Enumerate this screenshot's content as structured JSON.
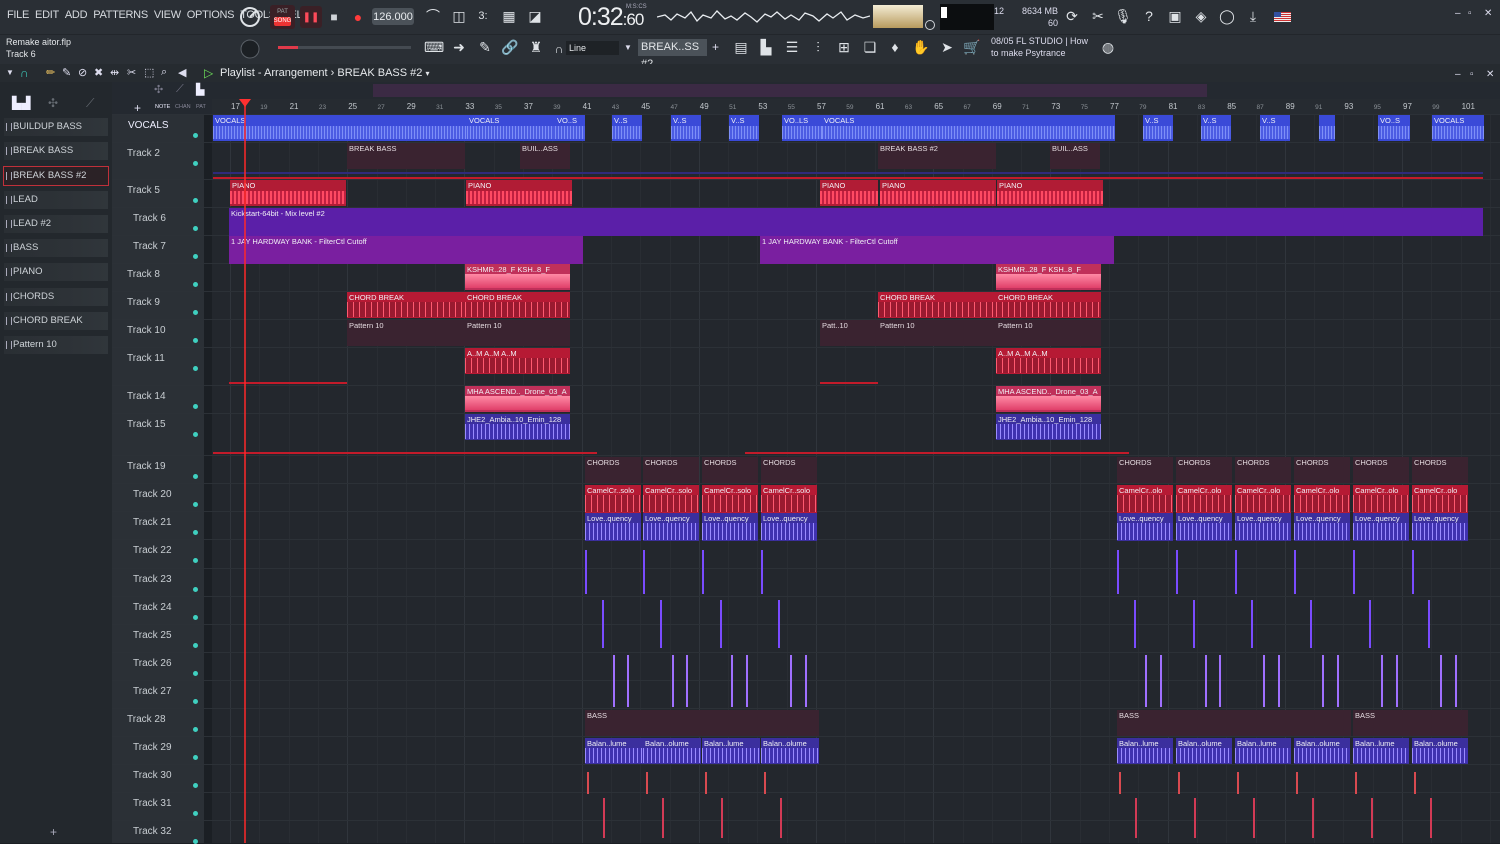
{
  "menu": [
    "FILE",
    "EDIT",
    "ADD",
    "PATTERNS",
    "VIEW",
    "OPTIONS",
    "TOOLS",
    "HELP"
  ],
  "transport": {
    "pat_label": "PAT",
    "song_label": "SONG",
    "tempo": "126.000",
    "time": "0:32",
    "time_sub": ":60",
    "time_unit": "M:S:CS"
  },
  "cpu": {
    "voices": "12",
    "memory": "8634 MB",
    "polyphony": "60"
  },
  "project": {
    "file": "Remake aitor.flp",
    "hint": "Track 6"
  },
  "toolbar2": {
    "snap_mode": "Line",
    "pattern": "BREAK..SS #2"
  },
  "news": {
    "date": "08/05",
    "line1": "FL STUDIO | How",
    "line2": "to make Psytrance"
  },
  "playlist": {
    "title": "Playlist - Arrangement",
    "separator": "›",
    "pattern": "BREAK BASS #2",
    "tabs": [
      "NOTE",
      "CHAN",
      "PAT"
    ]
  },
  "browser_items": [
    "BUILDUP BASS",
    "BREAK BASS",
    "BREAK BASS #2",
    "LEAD",
    "LEAD #2",
    "BASS",
    "PIANO",
    "CHORDS",
    "CHORD BREAK",
    "Pattern 10"
  ],
  "selected_browser_item": "BREAK BASS #2",
  "ruler": [
    "17",
    "19",
    "21",
    "23",
    "25",
    "27",
    "29",
    "31",
    "33",
    "35",
    "37",
    "39",
    "41",
    "43",
    "45",
    "47",
    "49",
    "51",
    "53",
    "55",
    "57",
    "59",
    "61",
    "63",
    "65",
    "67",
    "69",
    "71",
    "73",
    "75",
    "77",
    "79",
    "81",
    "83",
    "85",
    "87",
    "89",
    "91",
    "93",
    "95",
    "97",
    "99",
    "101"
  ],
  "tracks": [
    {
      "name": "VOCALS"
    },
    {
      "name": "Track 2"
    },
    {
      "name": "Track 5"
    },
    {
      "name": "Track 6"
    },
    {
      "name": "Track 7"
    },
    {
      "name": "Track 8"
    },
    {
      "name": "Track 9"
    },
    {
      "name": "Track 10"
    },
    {
      "name": "Track 11"
    },
    {
      "name": "Track 14"
    },
    {
      "name": "Track 15"
    },
    {
      "name": "Track 19"
    },
    {
      "name": "Track 20"
    },
    {
      "name": "Track 21"
    },
    {
      "name": "Track 22"
    },
    {
      "name": "Track 23"
    },
    {
      "name": "Track 24"
    },
    {
      "name": "Track 25"
    },
    {
      "name": "Track 26"
    },
    {
      "name": "Track 27"
    },
    {
      "name": "Track 28"
    },
    {
      "name": "Track 29"
    },
    {
      "name": "Track 30"
    },
    {
      "name": "Track 31"
    },
    {
      "name": "Track 32"
    }
  ],
  "clip_labels": {
    "vocals": "VOCALS",
    "vo_s": "VO..S",
    "v_s": "V..S",
    "vo_ls": "VO..LS",
    "break_bass": "BREAK BASS",
    "buil_ass": "BUIL..ASS",
    "break_bass2": "BREAK BASS #2",
    "piano": "PIANO",
    "kickstart": "Kickstart-64bit - Mix level #2",
    "jay": "1 JAY HARDWAY BANK - FilterCtl Cutoff",
    "kshmr": "KSHMR..28_F",
    "ksh": "KSH..8_F",
    "chord_break": "CHORD BREAK",
    "pattern10": "Pattern 10",
    "patt10": "Patt..10",
    "am": "A..M",
    "mha": "MHA ASCEND.._Drone_03_A",
    "jhe": "JHE2_Ambia..10_Emin_128",
    "chords": "CHORDS",
    "camel": "CamelCr..solo",
    "camel_b": "CamelCr..olo",
    "love": "Love..quency",
    "bass": "BASS",
    "balan": "Balan..olume",
    "balan_b": "Balan..lume"
  }
}
